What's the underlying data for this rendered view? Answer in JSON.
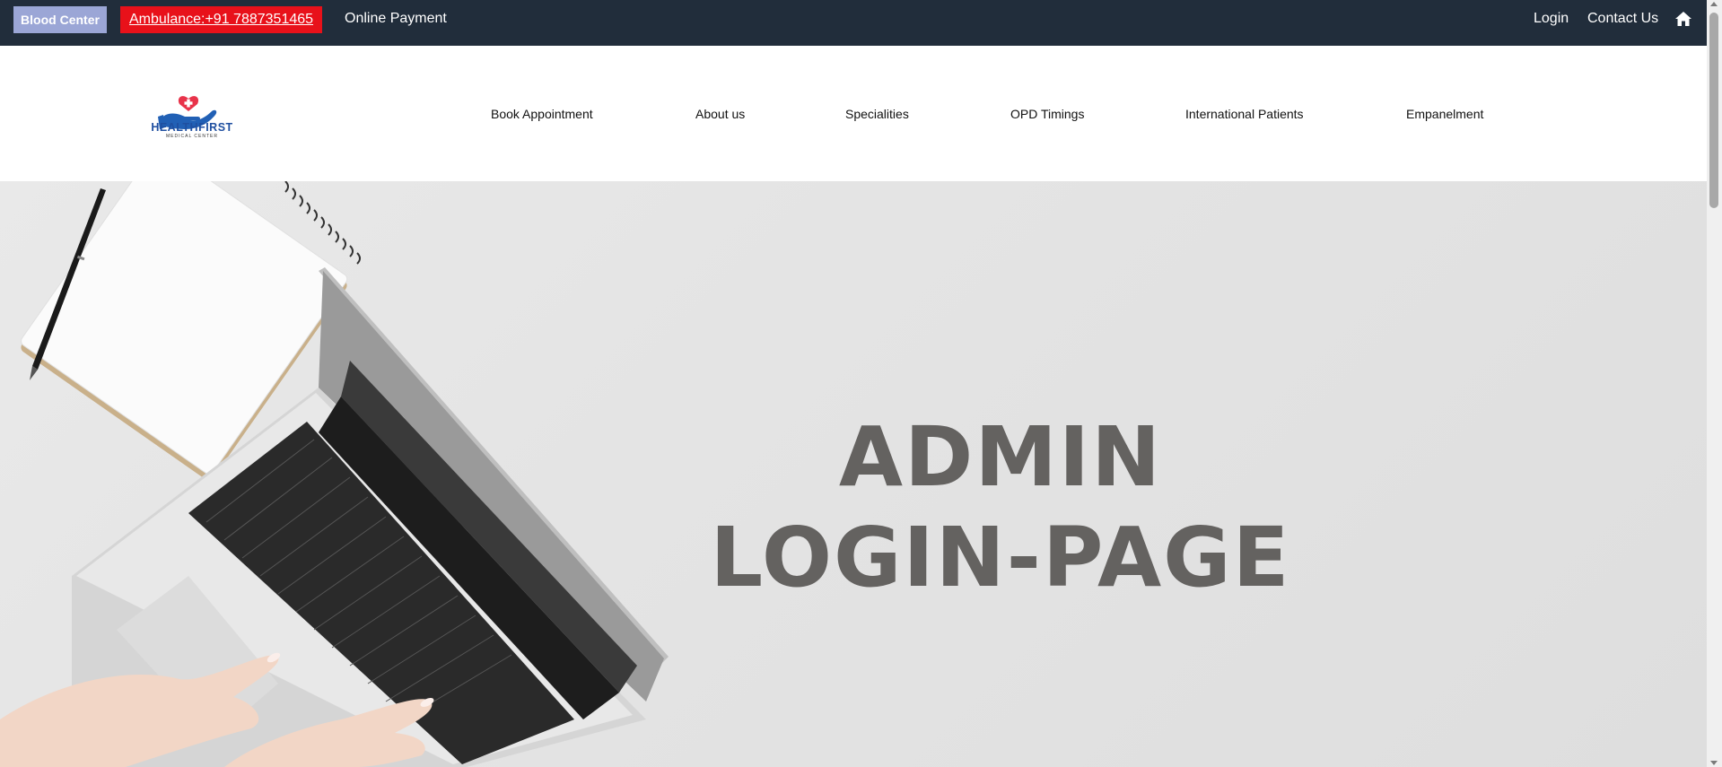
{
  "topbar": {
    "blood_center": "Blood Center",
    "ambulance": "Ambulance:+91 7887351465",
    "online_payment": "Online Payment",
    "login": "Login",
    "contact_us": "Contact Us"
  },
  "logo": {
    "name": "HEALTHFIRST",
    "sub": "MEDICAL CENTER"
  },
  "nav": {
    "items": [
      {
        "label": "Book Appointment"
      },
      {
        "label": "About us"
      },
      {
        "label": "Specialities"
      },
      {
        "label": "OPD Timings"
      },
      {
        "label": "International Patients"
      },
      {
        "label": "Empanelment"
      }
    ]
  },
  "hero": {
    "line1": "ADMIN",
    "line2": "LOGIN-PAGE"
  },
  "colors": {
    "topbar_bg": "#212d3b",
    "blood_btn": "#9ba6d6",
    "ambulance_btn": "#e8111a",
    "logo_blue": "#1f4fa0",
    "logo_red": "#e8334a",
    "hero_text": "#646260"
  },
  "icons": {
    "home": "home-icon",
    "logo": "hand-heart-cross-logo"
  }
}
